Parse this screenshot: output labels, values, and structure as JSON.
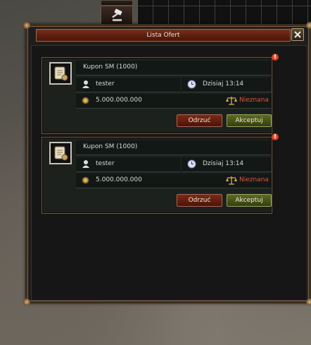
{
  "window": {
    "title": "Lista Ofert"
  },
  "offers": [
    {
      "item_name": "Kupon SM (1000)",
      "seller": "tester",
      "date": "Dzisiaj 13:14",
      "price": "5.000.000.000",
      "status": "Nieznana",
      "reject_label": "Odrzuć",
      "accept_label": "Akceptuj",
      "alert": "!"
    },
    {
      "item_name": "Kupon SM (1000)",
      "seller": "tester",
      "date": "Dzisiaj 13:14",
      "price": "5.000.000.000",
      "status": "Nieznana",
      "reject_label": "Odrzuć",
      "accept_label": "Akceptuj",
      "alert": "!"
    }
  ],
  "icons": {
    "auction": "gavel-icon",
    "close": "close-icon",
    "item": "scroll-icon",
    "seller": "user-icon",
    "date": "clock-icon",
    "price": "coin-icon",
    "status": "scales-icon"
  },
  "colors": {
    "title_bar": "#5c1d10",
    "status_unknown": "#e0523a",
    "reject_button": "#7a2a18",
    "accept_button": "#5c6a22"
  }
}
